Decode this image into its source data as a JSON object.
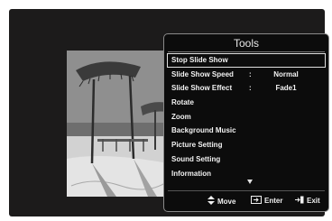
{
  "menu": {
    "title": "Tools",
    "items": [
      {
        "label": "Stop Slide Show",
        "selected": true
      },
      {
        "label": "Slide Show Speed",
        "colon": ":",
        "value": "Normal"
      },
      {
        "label": "Slide Show Effect",
        "colon": ":",
        "value": "Fade1"
      },
      {
        "label": "Rotate"
      },
      {
        "label": "Zoom"
      },
      {
        "label": "Background Music"
      },
      {
        "label": "Picture Setting"
      },
      {
        "label": "Sound Setting"
      },
      {
        "label": "Information"
      }
    ]
  },
  "footer": {
    "move_label": "Move",
    "enter_label": "Enter",
    "exit_label": "Exit",
    "move_icon": "up-down-arrows-icon",
    "enter_icon": "enter-icon",
    "exit_icon": "exit-icon"
  },
  "colors": {
    "menu_background": "#0c0c0c",
    "screen_background": "#1c1b1b",
    "selection_border": "#e0e0e0"
  }
}
